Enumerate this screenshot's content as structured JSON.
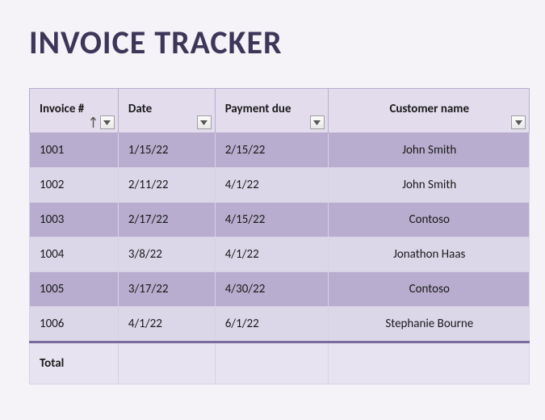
{
  "title": "INVOICE TRACKER",
  "columns": {
    "invoice": "Invoice #",
    "date": "Date",
    "due": "Payment due",
    "customer": "Customer name"
  },
  "rows": [
    {
      "invoice": "1001",
      "date": "1/15/22",
      "due": "2/15/22",
      "customer": "John Smith"
    },
    {
      "invoice": "1002",
      "date": "2/11/22",
      "due": "4/1/22",
      "customer": "John Smith"
    },
    {
      "invoice": "1003",
      "date": "2/17/22",
      "due": "4/15/22",
      "customer": "Contoso"
    },
    {
      "invoice": "1004",
      "date": "3/8/22",
      "due": "4/1/22",
      "customer": "Jonathon Haas"
    },
    {
      "invoice": "1005",
      "date": "3/17/22",
      "due": "4/30/22",
      "customer": "Contoso"
    },
    {
      "invoice": "1006",
      "date": "4/1/22",
      "due": "6/1/22",
      "customer": "Stephanie Bourne"
    }
  ],
  "footer": {
    "total_label": "Total"
  }
}
